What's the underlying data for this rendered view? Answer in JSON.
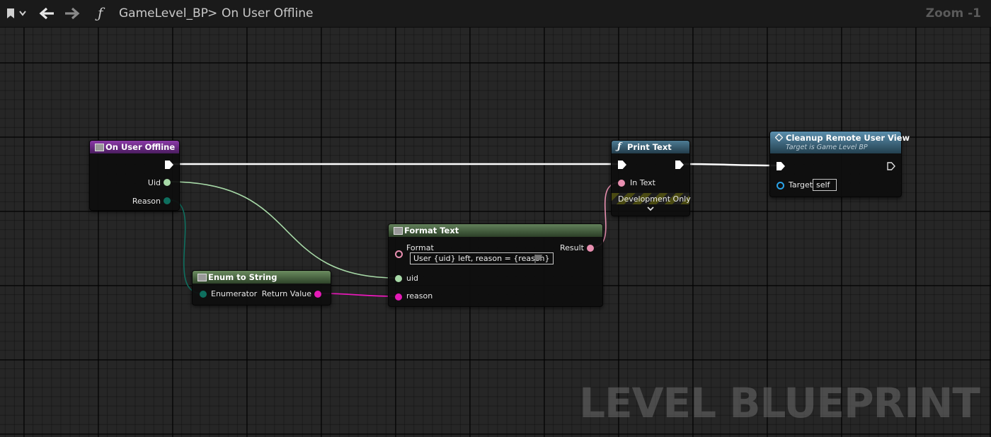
{
  "topbar": {
    "breadcrumb_root": "GameLevel_BP",
    "breadcrumb_separator": ">",
    "breadcrumb_current": "On User Offline",
    "zoom": "Zoom -1",
    "function_icon": "ƒ"
  },
  "watermark": "LEVEL BLUEPRINT",
  "nodes": {
    "on_user_offline": {
      "title": "On User Offline",
      "pins": {
        "uid": "Uid",
        "reason": "Reason"
      },
      "color": "#6a2a84"
    },
    "enum_to_string": {
      "title": "Enum to String",
      "pins": {
        "enumerator": "Enumerator",
        "return_value": "Return Value"
      },
      "color": "#4d6b45"
    },
    "format_text": {
      "title": "Format Text",
      "pins": {
        "format": "Format",
        "result": "Result",
        "uid": "uid",
        "reason": "reason"
      },
      "format_value": "User {uid} left, reason = {reason}",
      "color": "#4a6344"
    },
    "print_text": {
      "title": "Print Text",
      "pins": {
        "in_text": "In Text"
      },
      "dev_label": "Development Only",
      "color": "#3b5f73"
    },
    "cleanup_remote_user_view": {
      "title": "Cleanup Remote User View",
      "subtitle": "Target is Game Level BP",
      "pins": {
        "target": "Target"
      },
      "target_value": "self",
      "color": "#3f6f8a"
    }
  },
  "colors": {
    "exec_wire": "#ffffff",
    "uid_wire": "#a7d9a7",
    "enum_wire": "#0e6f5f",
    "string_wire": "#e51ab7",
    "text_wire": "#e88fb0",
    "object_pin": "#2aa3e8"
  }
}
